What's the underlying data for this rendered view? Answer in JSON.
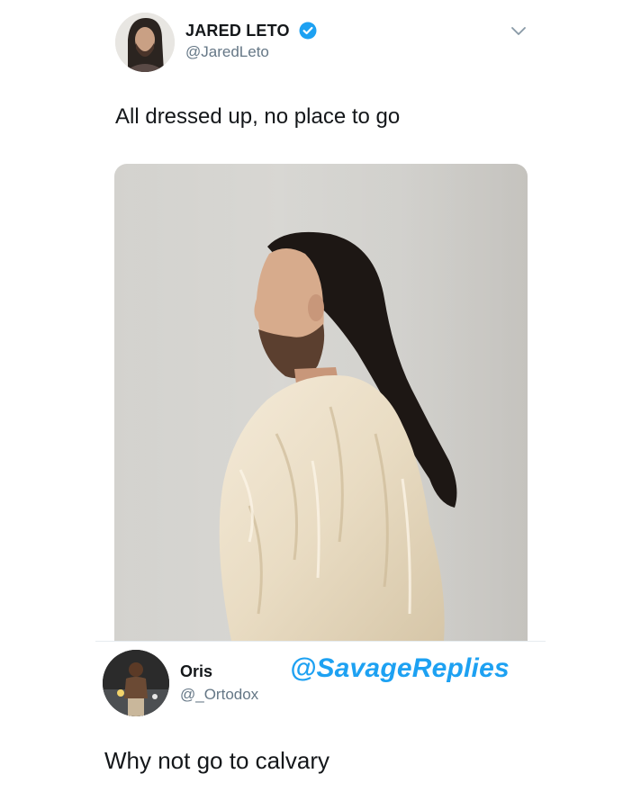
{
  "tweet": {
    "display_name": "JARED LETO",
    "handle": "@JaredLeto",
    "verified": true,
    "text": "All dressed up, no place to go",
    "avatar_icon": "profile-photo",
    "menu_icon": "chevron-down-icon"
  },
  "reply": {
    "display_name": "Oris",
    "handle": "@_Ortodox",
    "text": "Why not go to calvary",
    "avatar_icon": "profile-photo"
  },
  "watermark": "@SavageReplies",
  "colors": {
    "verified_badge": "#1da1f2",
    "watermark": "#1da1f2",
    "handle": "#657786",
    "text": "#14171a"
  }
}
